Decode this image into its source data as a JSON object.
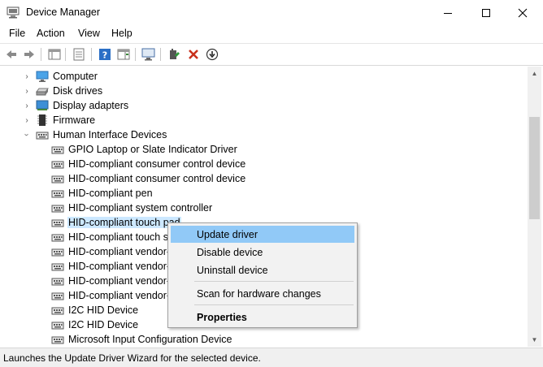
{
  "window": {
    "title": "Device Manager",
    "minimize_icon": "minimize-icon",
    "maximize_icon": "maximize-icon",
    "close_icon": "close-icon"
  },
  "menu": [
    "File",
    "Action",
    "View",
    "Help"
  ],
  "toolbar": [
    "back-arrow-icon",
    "forward-arrow-icon",
    "show-hide-console-tree-icon",
    "properties-icon",
    "help-icon",
    "action-pane-icon",
    "monitor-icon",
    "update-driver-icon",
    "uninstall-x-icon",
    "download-arrow-icon"
  ],
  "tree": {
    "categories": [
      {
        "label": "Computer",
        "expanded": false,
        "icon": "computer-icon"
      },
      {
        "label": "Disk drives",
        "expanded": false,
        "icon": "disk-drive-icon"
      },
      {
        "label": "Display adapters",
        "expanded": false,
        "icon": "display-adapter-icon"
      },
      {
        "label": "Firmware",
        "expanded": false,
        "icon": "firmware-chip-icon"
      },
      {
        "label": "Human Interface Devices",
        "expanded": true,
        "icon": "hid-icon"
      }
    ],
    "hid_devices": [
      "GPIO Laptop or Slate Indicator Driver",
      "HID-compliant consumer control device",
      "HID-compliant consumer control device",
      "HID-compliant pen",
      "HID-compliant system controller",
      "HID-compliant touch pad",
      "HID-compliant touch sc",
      "HID-compliant vendor-",
      "HID-compliant vendor-",
      "HID-compliant vendor-",
      "HID-compliant vendor-",
      "I2C HID Device",
      "I2C HID Device",
      "Microsoft Input Configuration Device"
    ],
    "selected_device": "HID-compliant touch pad"
  },
  "context_menu": {
    "update_driver": "Update driver",
    "disable_device": "Disable device",
    "uninstall_device": "Uninstall device",
    "scan_hardware": "Scan for hardware changes",
    "properties": "Properties"
  },
  "status_bar": {
    "text": "Launches the Update Driver Wizard for the selected device."
  }
}
